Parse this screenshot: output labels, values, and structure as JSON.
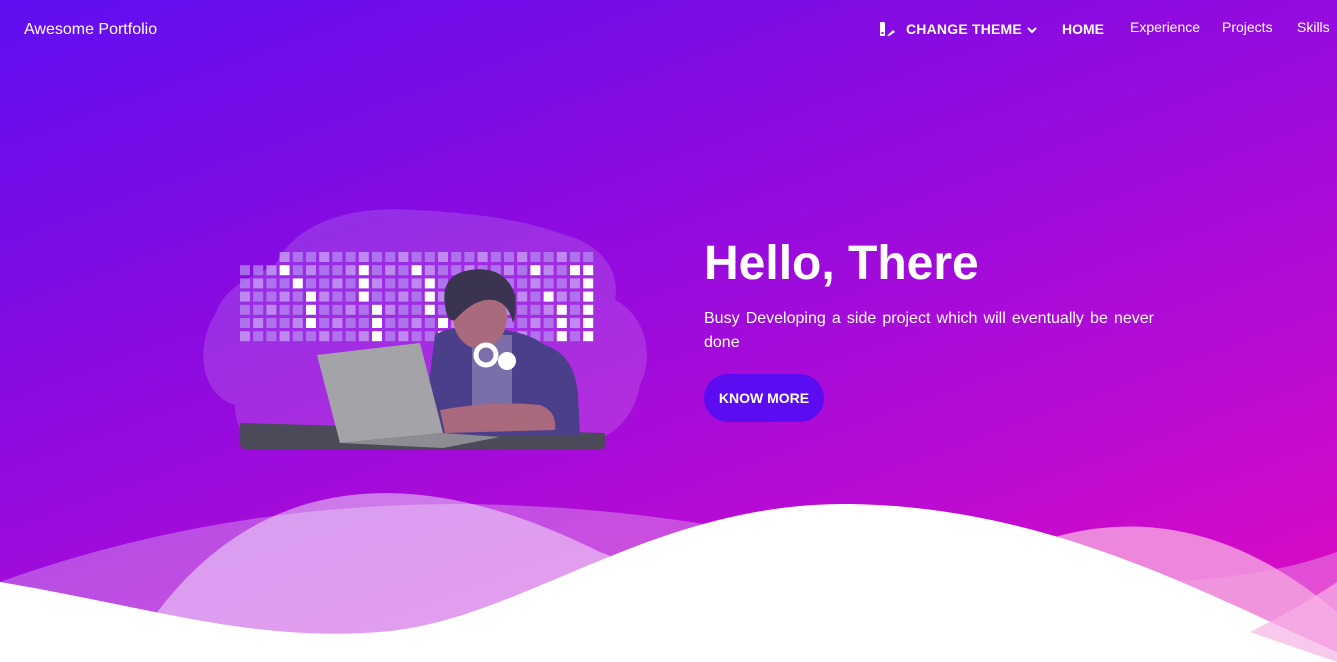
{
  "header": {
    "brand": "Awesome Portfolio",
    "theme_label": "CHANGE THEME",
    "nav": [
      {
        "label": "HOME"
      },
      {
        "label": "Experience"
      },
      {
        "label": "Projects"
      },
      {
        "label": "Skills"
      }
    ]
  },
  "hero": {
    "headline": "Hello, There",
    "subtitle": "Busy Developing a side project which will eventually be never done",
    "cta_label": "KNOW MORE"
  },
  "colors": {
    "gradient_start": "#5f0ef0",
    "gradient_end": "#e20bbf",
    "cta_bg": "#5c0cf0"
  }
}
